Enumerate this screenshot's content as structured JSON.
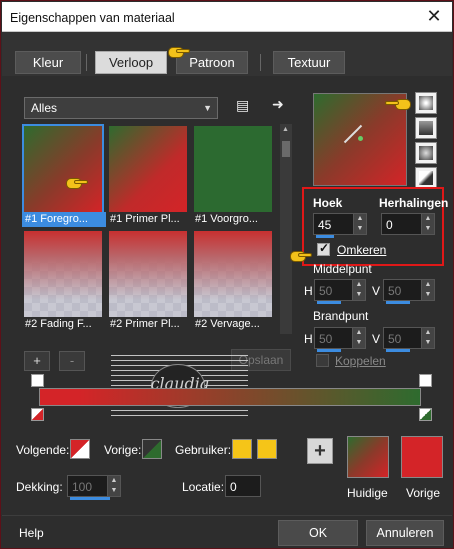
{
  "window": {
    "title": "Eigenschappen van materiaal",
    "close_label": "✕"
  },
  "tabs": [
    {
      "label": "Kleur",
      "active": false
    },
    {
      "label": "Verloop",
      "active": true
    },
    {
      "label": "Patroon",
      "active": false
    },
    {
      "label": "Textuur",
      "active": false
    }
  ],
  "library": {
    "dropdown_value": "Alles",
    "items": [
      {
        "label": "#1 Foregro...",
        "selected": true
      },
      {
        "label": "#1 Primer Pl...",
        "selected": false
      },
      {
        "label": "#1 Voorgro...",
        "selected": false
      },
      {
        "label": "#2 Fading F...",
        "selected": false
      },
      {
        "label": "#2 Primer Pl...",
        "selected": false
      },
      {
        "label": "#2 Vervage...",
        "selected": false
      }
    ],
    "add_label": "+",
    "remove_label": "-",
    "save_label": "Opslaan"
  },
  "settings": {
    "angle_label": "Hoek",
    "angle_value": "45",
    "repeats_label": "Herhalingen",
    "repeats_value": "0",
    "invert_label": "Omkeren",
    "invert_checked": true,
    "center_label": "Middelpunt",
    "center_h_label": "H",
    "center_h_value": "50",
    "center_v_label": "V",
    "center_v_value": "50",
    "focus_label": "Brandpunt",
    "focus_h_label": "H",
    "focus_h_value": "50",
    "focus_v_label": "V",
    "focus_v_value": "50",
    "link_label": "Koppelen",
    "link_checked": false
  },
  "stops": {
    "next_label": "Volgende:",
    "prev_label": "Vorige:",
    "user_label": "Gebruiker:",
    "opacity_label": "Dekking:",
    "opacity_value": "100",
    "location_label": "Locatie:",
    "location_value": "0"
  },
  "colors": {
    "red": "#d42428",
    "green": "#2e6b2e",
    "accent": "#3c8ce0",
    "highlight": "#e01818",
    "user_yellow": "#f5c518"
  },
  "preview": {
    "current_label": "Huidige",
    "previous_label": "Vorige",
    "add_label": "+"
  },
  "watermark": {
    "text": "claudia"
  },
  "footer": {
    "help_label": "Help",
    "ok_label": "OK",
    "cancel_label": "Annuleren"
  }
}
